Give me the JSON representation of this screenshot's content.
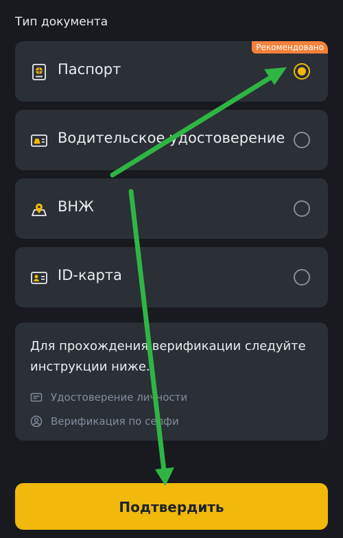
{
  "section_title": "Тип документа",
  "options": [
    {
      "label": "Паспорт",
      "icon": "passport-icon",
      "selected": true,
      "badge": "Рекомендовано"
    },
    {
      "label": "Водительское удостоверение",
      "icon": "driver-license-icon",
      "selected": false
    },
    {
      "label": "ВНЖ",
      "icon": "residence-permit-icon",
      "selected": false
    },
    {
      "label": "ID-карта",
      "icon": "id-card-icon",
      "selected": false
    }
  ],
  "info": {
    "text": "Для прохождения верификации следуйте инструкции ниже.",
    "items": [
      {
        "label": "Удостоверение личности",
        "icon": "id-document-icon"
      },
      {
        "label": "Верификация по селфи",
        "icon": "selfie-icon"
      }
    ]
  },
  "confirm_label": "Подтвердить",
  "colors": {
    "background": "#181a20",
    "card": "#2b2f36",
    "accent": "#f0b90b",
    "badge": "#f6813b",
    "annotation_arrow": "#2fb544"
  }
}
